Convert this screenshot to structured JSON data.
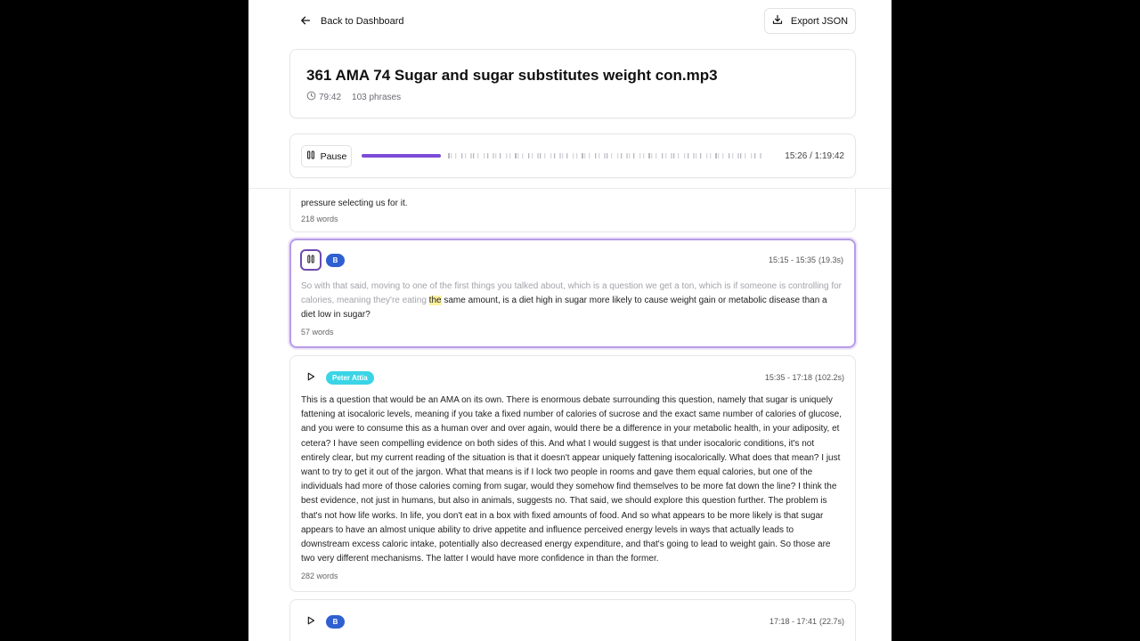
{
  "nav": {
    "back_label": "Back to Dashboard",
    "export_label": "Export JSON"
  },
  "header": {
    "title": "361 AMA 74 Sugar and sugar substitutes weight con.mp3",
    "duration": "79:42",
    "phrases": "103 phrases"
  },
  "player": {
    "button_label": "Pause",
    "time": "15:26 / 1:19:42",
    "progress": 0.196,
    "accent": "#7c4bd8"
  },
  "segments": [
    {
      "text": "pressure selecting us for it.",
      "words": "218 words"
    },
    {
      "speaker": "B",
      "range": "15:15 - 15:35",
      "dur": "(19.3s)",
      "text_read": "So with that said, moving to one of the first things you talked about, which is a question we get a ton, which is if someone is controlling for calories, meaning they're eating ",
      "text_current": "the",
      "text_rest": " same amount, is a diet high in sugar more likely to cause weight gain or metabolic disease than a diet low in sugar?",
      "words": "57 words"
    },
    {
      "speaker": "Peter Attia",
      "range": "15:35 - 17:18",
      "dur": "(102.2s)",
      "text": "This is a question that would be an AMA on its own. There is enormous debate surrounding this question, namely that sugar is uniquely fattening at isocaloric levels, meaning if you take a fixed number of calories of sucrose and the exact same number of calories of glucose, and you were to consume this as a human over and over again, would there be a difference in your metabolic health, in your adiposity, et cetera? I have seen compelling evidence on both sides of this. And what I would suggest is that under isocaloric conditions, it's not entirely clear, but my current reading of the situation is that it doesn't appear uniquely fattening isocalorically. What does that mean? I just want to try to get it out of the jargon. What that means is if I lock two people in rooms and gave them equal calories, but one of the individuals had more of those calories coming from sugar, would they somehow find themselves to be more fat down the line? I think the best evidence, not just in humans, but also in animals, suggests no. That said, we should explore this question further. The problem is that's not how life works. In life, you don't eat in a box with fixed amounts of food. And so what appears to be more likely is that sugar appears to have an almost unique ability to drive appetite and influence perceived energy levels in ways that actually leads to downstream excess caloric intake, potentially also decreased energy expenditure, and that's going to lead to weight gain. So those are two very different mechanisms. The latter I would have more confidence in than the former.",
      "words": "282 words"
    },
    {
      "speaker": "B",
      "range": "17:18 - 17:41",
      "dur": "(22.7s)"
    }
  ]
}
